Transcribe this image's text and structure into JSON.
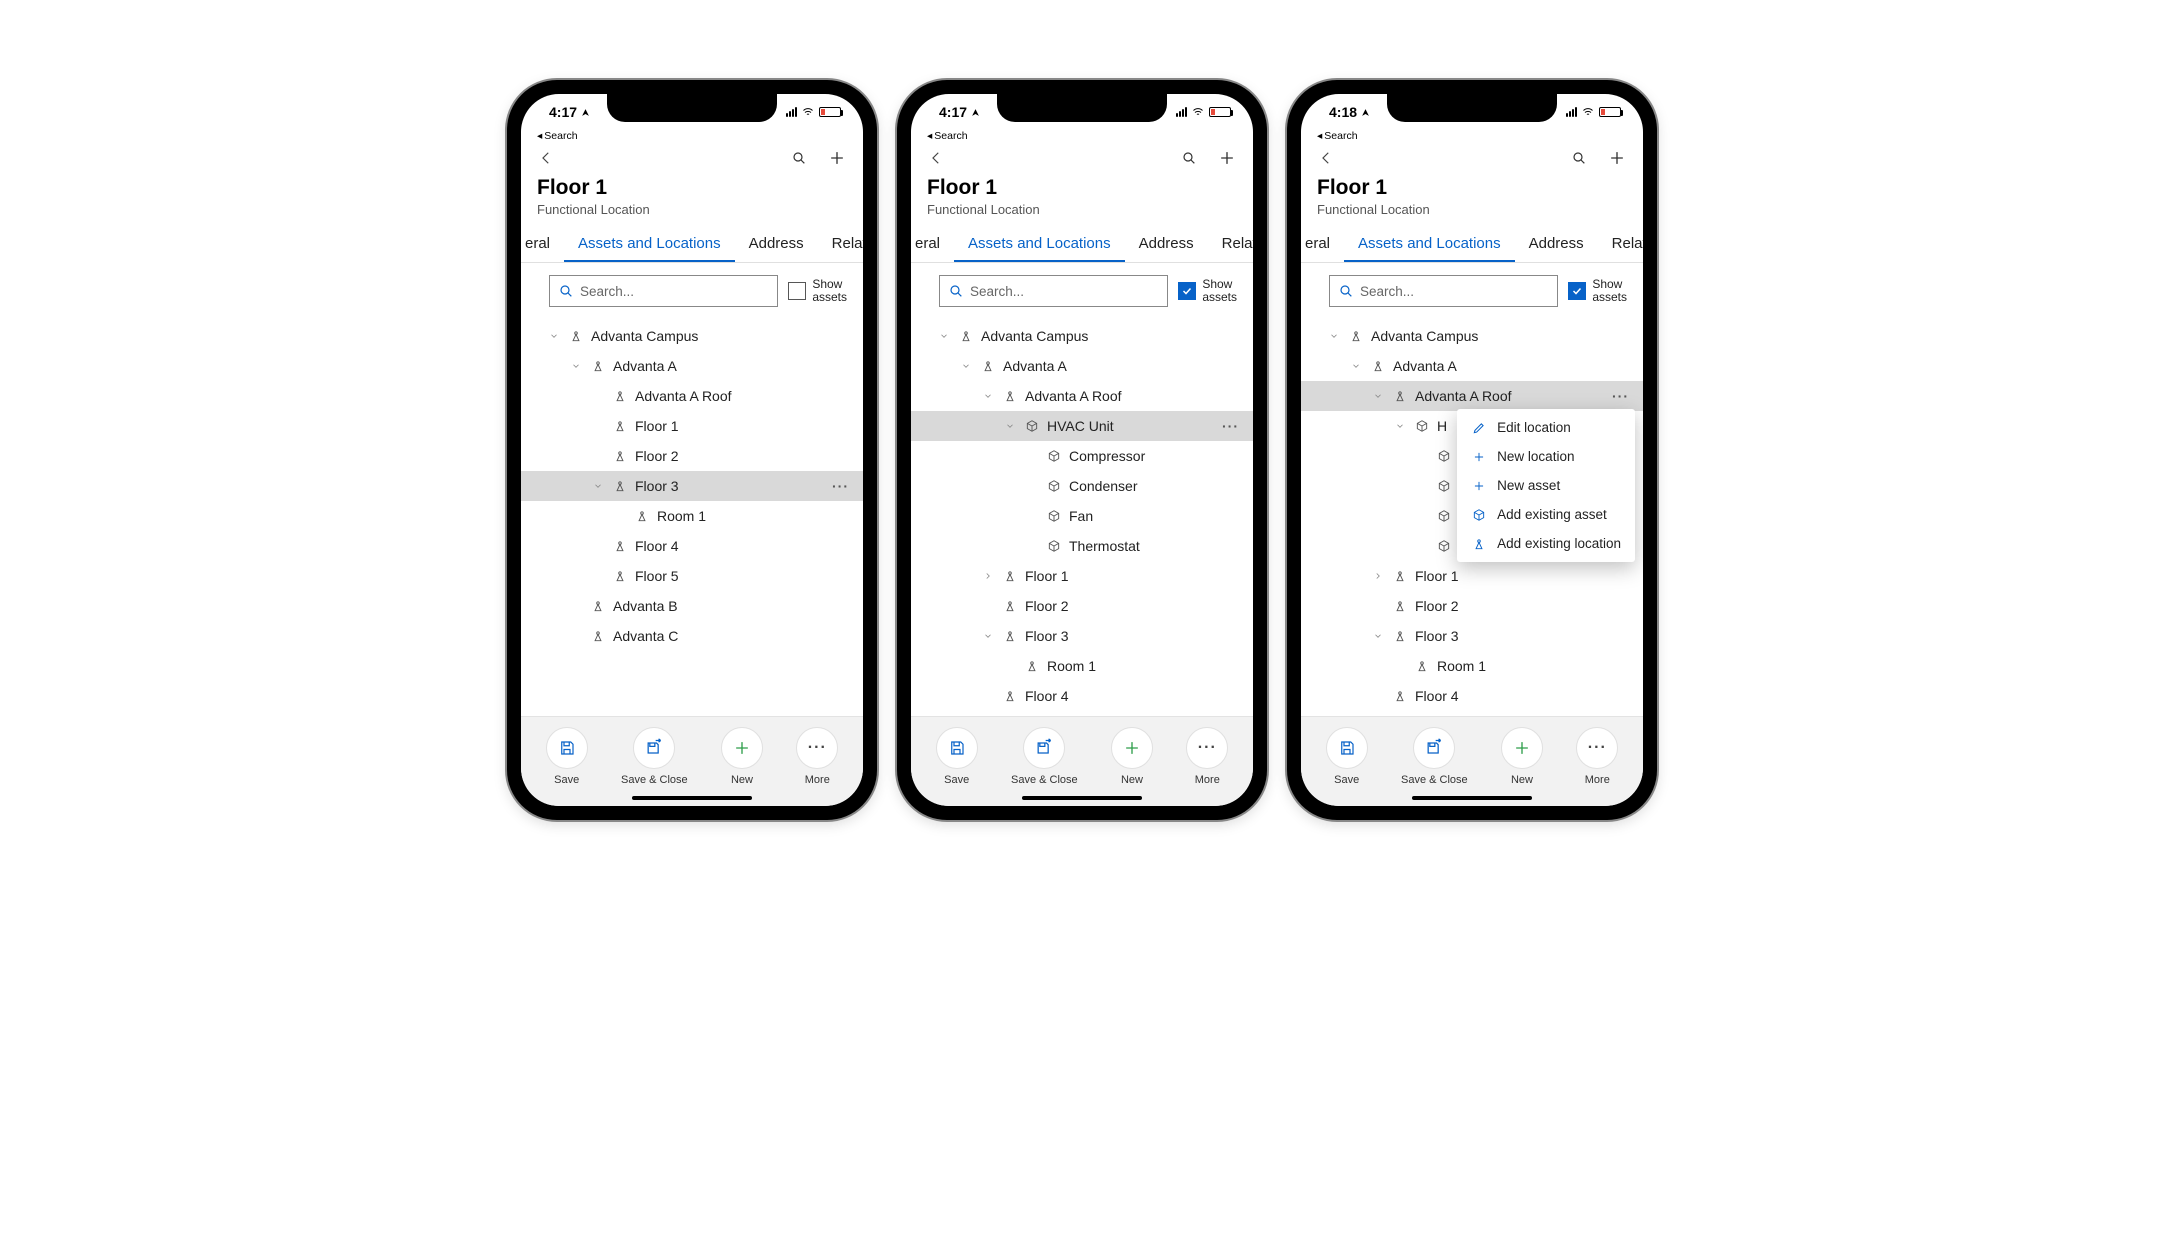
{
  "colors": {
    "accent": "#0762c8"
  },
  "statusbar": {
    "back_text": "Search"
  },
  "header": {
    "title": "Floor 1",
    "subtitle": "Functional Location"
  },
  "tabs": {
    "partial_left": "eral",
    "active": "Assets and Locations",
    "t3": "Address",
    "partial_right": "Relate"
  },
  "search": {
    "placeholder": "Search...",
    "checkbox_label_l1": "Show",
    "checkbox_label_l2": "assets"
  },
  "bottom": {
    "save": "Save",
    "save_close": "Save & Close",
    "new": "New",
    "more": "More"
  },
  "phones": [
    {
      "time": "4:17",
      "show_assets_checked": false,
      "tree": [
        {
          "indent": 1,
          "chev": "down",
          "icon": "loc",
          "label": "Advanta Campus"
        },
        {
          "indent": 2,
          "chev": "down",
          "icon": "loc",
          "label": "Advanta A"
        },
        {
          "indent": 3,
          "chev": "",
          "icon": "loc",
          "label": "Advanta A Roof"
        },
        {
          "indent": 3,
          "chev": "",
          "icon": "loc",
          "label": "Floor 1"
        },
        {
          "indent": 3,
          "chev": "",
          "icon": "loc",
          "label": "Floor 2"
        },
        {
          "indent": 3,
          "chev": "down",
          "icon": "loc",
          "label": "Floor 3",
          "selected": true,
          "dots": true
        },
        {
          "indent": 4,
          "chev": "",
          "icon": "loc",
          "label": "Room 1"
        },
        {
          "indent": 3,
          "chev": "",
          "icon": "loc",
          "label": "Floor 4"
        },
        {
          "indent": 3,
          "chev": "",
          "icon": "loc",
          "label": "Floor 5"
        },
        {
          "indent": 2,
          "chev": "",
          "icon": "loc",
          "label": "Advanta B"
        },
        {
          "indent": 2,
          "chev": "",
          "icon": "loc",
          "label": "Advanta C"
        }
      ],
      "context_menu": null
    },
    {
      "time": "4:17",
      "show_assets_checked": true,
      "tree": [
        {
          "indent": 1,
          "chev": "down",
          "icon": "loc",
          "label": "Advanta Campus"
        },
        {
          "indent": 2,
          "chev": "down",
          "icon": "loc",
          "label": "Advanta A"
        },
        {
          "indent": 3,
          "chev": "down",
          "icon": "loc",
          "label": "Advanta A Roof"
        },
        {
          "indent": 4,
          "chev": "down",
          "icon": "asset",
          "label": "HVAC Unit",
          "selected": true,
          "dots": true
        },
        {
          "indent": 5,
          "chev": "",
          "icon": "asset",
          "label": "Compressor"
        },
        {
          "indent": 5,
          "chev": "",
          "icon": "asset",
          "label": "Condenser"
        },
        {
          "indent": 5,
          "chev": "",
          "icon": "asset",
          "label": "Fan"
        },
        {
          "indent": 5,
          "chev": "",
          "icon": "asset",
          "label": "Thermostat"
        },
        {
          "indent": 3,
          "chev": "right",
          "icon": "loc",
          "label": "Floor 1"
        },
        {
          "indent": 3,
          "chev": "",
          "icon": "loc",
          "label": "Floor 2"
        },
        {
          "indent": 3,
          "chev": "down",
          "icon": "loc",
          "label": "Floor 3"
        },
        {
          "indent": 4,
          "chev": "",
          "icon": "loc",
          "label": "Room 1"
        },
        {
          "indent": 3,
          "chev": "",
          "icon": "loc",
          "label": "Floor 4"
        }
      ],
      "context_menu": null
    },
    {
      "time": "4:18",
      "show_assets_checked": true,
      "tree": [
        {
          "indent": 1,
          "chev": "down",
          "icon": "loc",
          "label": "Advanta Campus"
        },
        {
          "indent": 2,
          "chev": "down",
          "icon": "loc",
          "label": "Advanta A"
        },
        {
          "indent": 3,
          "chev": "down",
          "icon": "loc",
          "label": "Advanta A Roof",
          "selected": true,
          "dots": true
        },
        {
          "indent": 4,
          "chev": "down",
          "icon": "asset",
          "label": "H"
        },
        {
          "indent": 5,
          "chev": "",
          "icon": "asset",
          "label": ""
        },
        {
          "indent": 5,
          "chev": "",
          "icon": "asset",
          "label": ""
        },
        {
          "indent": 5,
          "chev": "",
          "icon": "asset",
          "label": ""
        },
        {
          "indent": 5,
          "chev": "",
          "icon": "asset",
          "label": ""
        },
        {
          "indent": 3,
          "chev": "right",
          "icon": "loc",
          "label": "Floor 1"
        },
        {
          "indent": 3,
          "chev": "",
          "icon": "loc",
          "label": "Floor 2"
        },
        {
          "indent": 3,
          "chev": "down",
          "icon": "loc",
          "label": "Floor 3"
        },
        {
          "indent": 4,
          "chev": "",
          "icon": "loc",
          "label": "Room 1"
        },
        {
          "indent": 3,
          "chev": "",
          "icon": "loc",
          "label": "Floor 4"
        }
      ],
      "context_menu": {
        "items": [
          {
            "icon": "pencil",
            "label": "Edit location"
          },
          {
            "icon": "plus",
            "label": "New location"
          },
          {
            "icon": "plus",
            "label": "New asset"
          },
          {
            "icon": "asset",
            "label": "Add existing asset"
          },
          {
            "icon": "loc",
            "label": "Add existing location"
          }
        ]
      }
    }
  ]
}
